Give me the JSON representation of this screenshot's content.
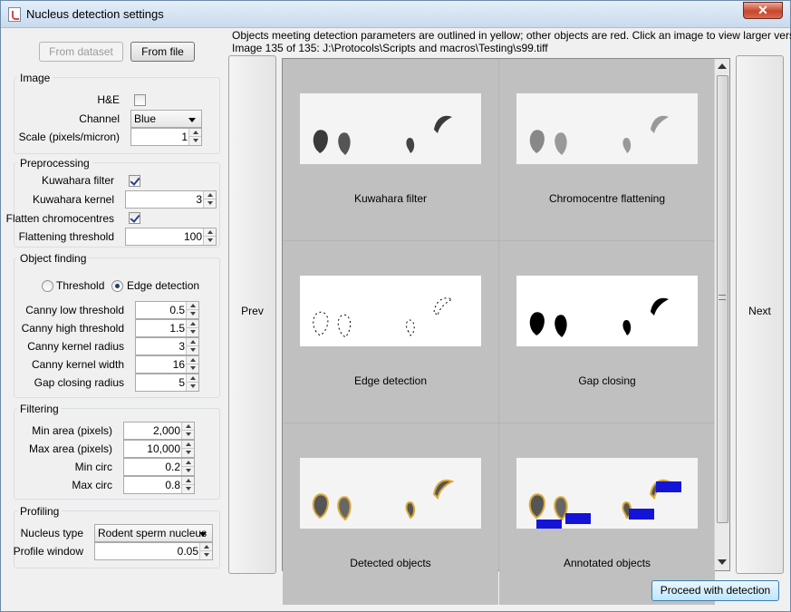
{
  "window": {
    "title": "Nucleus detection settings",
    "close_symbol": "✕"
  },
  "buttons": {
    "from_dataset": "From dataset",
    "from_file": "From file",
    "prev": "Prev",
    "next": "Next",
    "proceed": "Proceed with detection"
  },
  "image": {
    "group_label": "Image",
    "he_label": "H&E",
    "he_checked": false,
    "channel_label": "Channel",
    "channel_value": "Blue",
    "scale_label": "Scale (pixels/micron)",
    "scale_value": "1"
  },
  "preprocessing": {
    "group_label": "Preprocessing",
    "kuwahara_filter_label": "Kuwahara filter",
    "kuwahara_filter_checked": true,
    "kuwahara_kernel_label": "Kuwahara kernel",
    "kuwahara_kernel_value": "3",
    "flatten_label": "Flatten chromocentres",
    "flatten_checked": true,
    "flattening_threshold_label": "Flattening threshold",
    "flattening_threshold_value": "100"
  },
  "object_finding": {
    "group_label": "Object finding",
    "threshold_label": "Threshold",
    "edge_detection_label": "Edge detection",
    "selected_mode": "Edge detection",
    "canny_low_label": "Canny low threshold",
    "canny_low_value": "0.5",
    "canny_high_label": "Canny high threshold",
    "canny_high_value": "1.5",
    "canny_radius_label": "Canny kernel radius",
    "canny_radius_value": "3",
    "canny_width_label": "Canny kernel width",
    "canny_width_value": "16",
    "gap_label": "Gap closing radius",
    "gap_value": "5"
  },
  "filtering": {
    "group_label": "Filtering",
    "min_area_label": "Min area (pixels)",
    "min_area_value": "2,000",
    "max_area_label": "Max area (pixels)",
    "max_area_value": "10,000",
    "min_circ_label": "Min circ",
    "min_circ_value": "0.2",
    "max_circ_label": "Max circ",
    "max_circ_value": "0.8"
  },
  "profiling": {
    "group_label": "Profiling",
    "nucleus_type_label": "Nucleus type",
    "nucleus_type_value": "Rodent sperm nucleus",
    "profile_window_label": "Profile window",
    "profile_window_value": "0.05"
  },
  "info": {
    "line1": "Objects meeting detection parameters are outlined in yellow; other objects are red. Click an image to view larger version.",
    "line2": "Image 135 of 135: J:\\Protocols\\Scripts and macros\\Testing\\s99.tiff"
  },
  "panels": [
    {
      "caption": "Kuwahara filter"
    },
    {
      "caption": "Chromocentre flattening"
    },
    {
      "caption": "Edge detection"
    },
    {
      "caption": "Gap closing"
    },
    {
      "caption": "Detected objects"
    },
    {
      "caption": "Annotated objects"
    }
  ],
  "colors": {
    "titlebar": "#dbe8f6",
    "close": "#c8452a",
    "outline_yellow": "#d9a93a",
    "annotation_blue": "#1414d8"
  }
}
